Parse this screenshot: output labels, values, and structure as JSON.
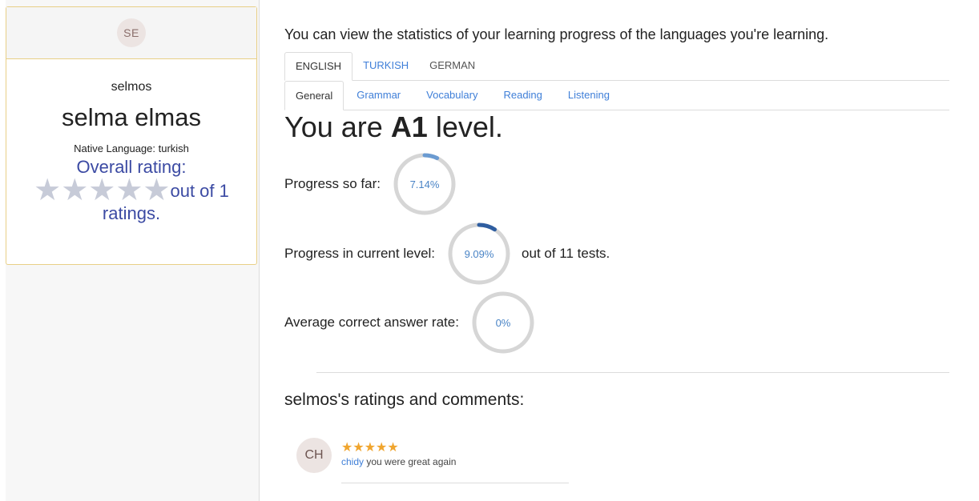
{
  "sidebar": {
    "avatar_initials": "SE",
    "username": "selmos",
    "full_name": "selma elmas",
    "native_language": "Native Language: turkish",
    "overall_rating_label": "Overall rating:",
    "rating_stars": "★★★★★",
    "rating_stars_filled": 0,
    "rating_stars_total": 5,
    "rating_suffix": "out of 1",
    "rating_suffix_2": "ratings."
  },
  "main": {
    "intro": "You can view the statistics of your learning progress of the languages you're learning.",
    "language_tabs": [
      {
        "label": "ENGLISH"
      },
      {
        "label": "TURKISH"
      },
      {
        "label": "GERMAN"
      }
    ],
    "section_tabs": [
      {
        "label": "General"
      },
      {
        "label": "Grammar"
      },
      {
        "label": "Vocabulary"
      },
      {
        "label": "Reading"
      },
      {
        "label": "Listening"
      }
    ],
    "level_prefix": "You are",
    "level_value": "A1",
    "level_suffix": "level.",
    "stats": [
      {
        "label": "Progress so far:",
        "percent_text": "7.14%",
        "fraction": 0.0714,
        "after": "",
        "color": "#6b9bd1"
      },
      {
        "label": "Progress in current level:",
        "percent_text": "9.09%",
        "fraction": 0.0909,
        "after": "out of 11 tests.",
        "color": "#2f5ea0"
      },
      {
        "label": "Average correct answer rate:",
        "percent_text": "0%",
        "fraction": 0,
        "after": "",
        "color": "#6b9bd1"
      }
    ],
    "ratings_heading": "selmos's ratings and comments:",
    "comments": [
      {
        "initials": "CH",
        "stars": "★★★★★",
        "author": "chidy",
        "text": " you were great again"
      }
    ]
  },
  "colors": {
    "accent_link": "#3f7fd8",
    "rating_text": "#3b4aa3",
    "star_gold": "#f0a52e",
    "card_border": "#e8cf86",
    "ring_track": "#d6d6d6"
  }
}
